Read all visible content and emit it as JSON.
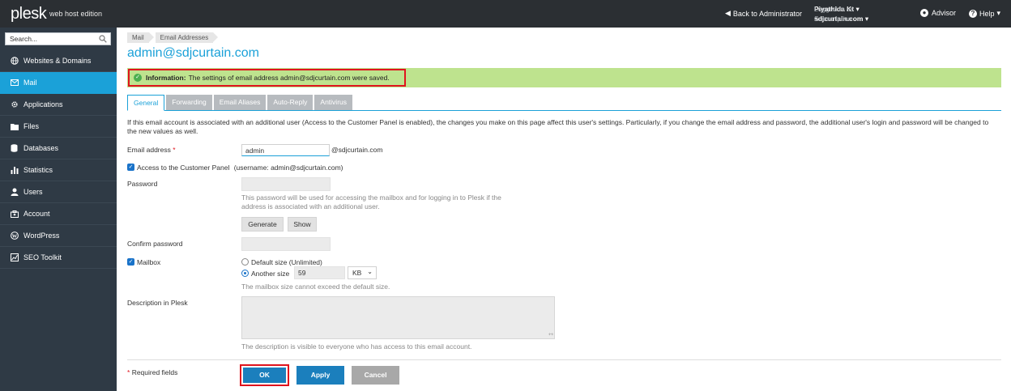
{
  "header": {
    "logo": "plesk",
    "edition": "web host edition",
    "back_link": "Back to Administrator",
    "logged_in_label": "Logged in as",
    "logged_in_user": "Piyathida Kt",
    "subscription_label": "Subscription",
    "subscription_value": "sdjcurtain.com",
    "advisor": "Advisor",
    "help": "Help"
  },
  "sidebar": {
    "search_placeholder": "Search...",
    "items": [
      {
        "label": "Websites & Domains",
        "icon": "globe-icon"
      },
      {
        "label": "Mail",
        "icon": "mail-icon"
      },
      {
        "label": "Applications",
        "icon": "gear-icon"
      },
      {
        "label": "Files",
        "icon": "folder-icon"
      },
      {
        "label": "Databases",
        "icon": "database-icon"
      },
      {
        "label": "Statistics",
        "icon": "bar-chart-icon"
      },
      {
        "label": "Users",
        "icon": "user-icon"
      },
      {
        "label": "Account",
        "icon": "account-icon"
      },
      {
        "label": "WordPress",
        "icon": "wordpress-icon"
      },
      {
        "label": "SEO Toolkit",
        "icon": "seo-icon"
      }
    ]
  },
  "breadcrumb": [
    "Mail",
    "Email Addresses"
  ],
  "page_title": "admin@sdjcurtain.com",
  "info": {
    "label": "Information:",
    "message": "The settings of email address admin@sdjcurtain.com were saved."
  },
  "tabs": [
    "General",
    "Forwarding",
    "Email Aliases",
    "Auto-Reply",
    "Antivirus"
  ],
  "intro_text": "If this email account is associated with an additional user (Access to the Customer Panel is enabled), the changes you make on this page affect this user's settings. Particularly, if you change the email address and password, the additional user's login and password will be changed to the new values as well.",
  "form": {
    "email_label": "Email address",
    "required_star": "*",
    "email_value": "admin",
    "email_domain": "@sdjcurtain.com",
    "access_label": "Access to the Customer Panel",
    "access_username": "(username: admin@sdjcurtain.com)",
    "password_label": "Password",
    "password_hint": "This password will be used for accessing the mailbox and for logging in to Plesk if the address is associated with an additional user.",
    "generate_button": "Generate",
    "show_button": "Show",
    "confirm_label": "Confirm password",
    "mailbox_label": "Mailbox",
    "default_size": "Default size (Unlimited)",
    "another_size": "Another size",
    "size_value": "59",
    "size_unit": "KB",
    "mailbox_hint": "The mailbox size cannot exceed the default size.",
    "description_label": "Description in Plesk",
    "description_hint": "The description is visible to everyone who has access to this email account."
  },
  "footer": {
    "required_note": "Required fields",
    "ok": "OK",
    "apply": "Apply",
    "cancel": "Cancel"
  }
}
